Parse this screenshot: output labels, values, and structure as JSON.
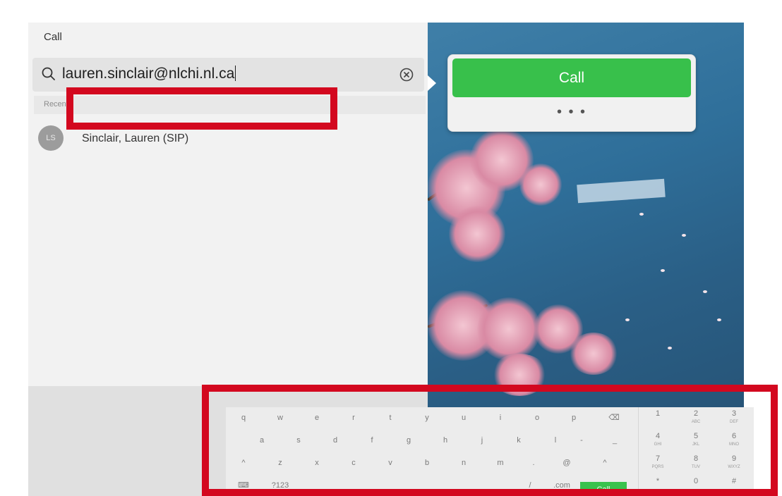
{
  "panel": {
    "title": "Call",
    "search_value": "lauren.sinclair@nlchi.nl.ca",
    "section_label": "Recents",
    "contact": {
      "initials": "LS",
      "name": "Sinclair, Lauren (SIP)"
    }
  },
  "popover": {
    "call_label": "Call",
    "more_label": "• • •"
  },
  "keyboard": {
    "row1": [
      "q",
      "w",
      "e",
      "r",
      "t",
      "y",
      "u",
      "i",
      "o",
      "p",
      "⌫"
    ],
    "row2": [
      "a",
      "s",
      "d",
      "f",
      "g",
      "h",
      "j",
      "k",
      "l",
      "-",
      "_"
    ],
    "row3": [
      "^",
      "z",
      "x",
      "c",
      "v",
      "b",
      "n",
      "m",
      ".",
      "@",
      "^"
    ],
    "row4": [
      "⌨",
      "?123",
      "/",
      ".com"
    ],
    "call_label": "Call",
    "numpad": [
      {
        "digit": "1",
        "letters": ""
      },
      {
        "digit": "2",
        "letters": "ABC"
      },
      {
        "digit": "3",
        "letters": "DEF"
      },
      {
        "digit": "4",
        "letters": "GHI"
      },
      {
        "digit": "5",
        "letters": "JKL"
      },
      {
        "digit": "6",
        "letters": "MNO"
      },
      {
        "digit": "7",
        "letters": "PQRS"
      },
      {
        "digit": "8",
        "letters": "TUV"
      },
      {
        "digit": "9",
        "letters": "WXYZ"
      },
      {
        "digit": "*",
        "letters": ""
      },
      {
        "digit": "0",
        "letters": ""
      },
      {
        "digit": "#",
        "letters": ""
      }
    ]
  },
  "colors": {
    "call_green": "#38c04b",
    "highlight_red": "#d3081f"
  }
}
